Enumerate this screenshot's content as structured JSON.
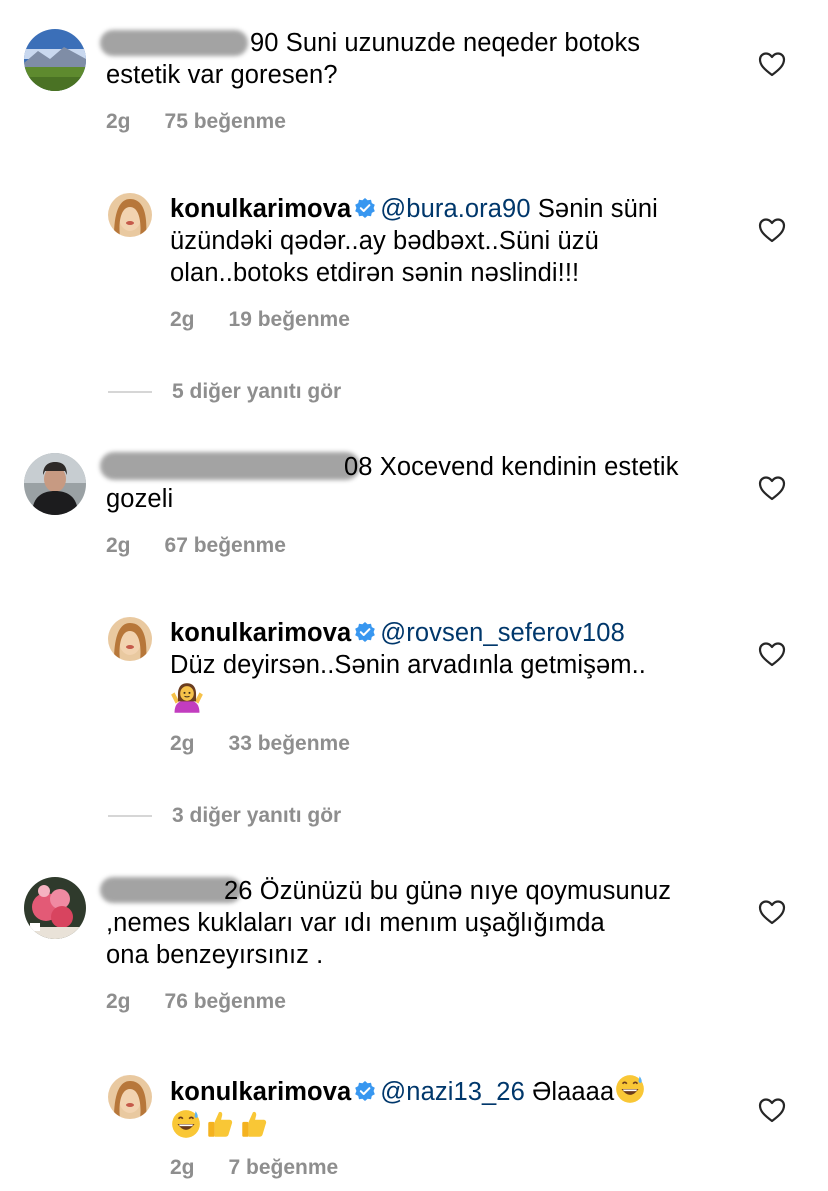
{
  "comments": [
    {
      "handle_suffix": "90",
      "text": "Suni uzunuzde neqeder botoks estetik var goresen?",
      "text_line1": "Suni uzunuzde neqeder botoks",
      "text_line2": "estetik var goresen?",
      "time": "2g",
      "likes": "75 beğenme",
      "reply": {
        "username": "konulkarimova",
        "mention": "@bura.ora90",
        "text_l1": "Sənin süni",
        "text_l2": "üzündəki qədər..ay bədbəxt..Süni üzü",
        "text_l3": "olan..botoks etdirən sənin nəslindi!!!",
        "time": "2g",
        "likes": "19 beğenme"
      },
      "view_replies": "5 diğer yanıtı gör"
    },
    {
      "handle_suffix": "08",
      "text_line1": "Xocevend kendinin estetik",
      "text_line2": "gozeli",
      "time": "2g",
      "likes": "67 beğenme",
      "reply": {
        "username": "konulkarimova",
        "mention": "@rovsen_seferov108",
        "text_l1": "Düz deyirsən..Sənin arvadınla getmişəm..",
        "emoji": "🤷‍♀️",
        "time": "2g",
        "likes": "33 beğenme"
      },
      "view_replies": "3 diğer yanıtı gör"
    },
    {
      "handle_suffix": "26",
      "text_line1": "Özünüzü bu günə nıye qoymusunuz",
      "text_line2": ",nemes kuklaları var ıdı menım uşağlığımda",
      "text_line3": "ona benzeyırsınız .",
      "time": "2g",
      "likes": "76 beğenme",
      "reply": {
        "username": "konulkarimova",
        "mention": "@nazi13_26",
        "text_l1": "Əlaaaa",
        "time": "2g",
        "likes": "7 beğenme"
      }
    }
  ],
  "colors": {
    "mention": "#00376b",
    "meta": "#8e8e8e",
    "verified": "#3897f0"
  },
  "icons": [
    "heart-outline-icon",
    "verified-badge-icon"
  ]
}
